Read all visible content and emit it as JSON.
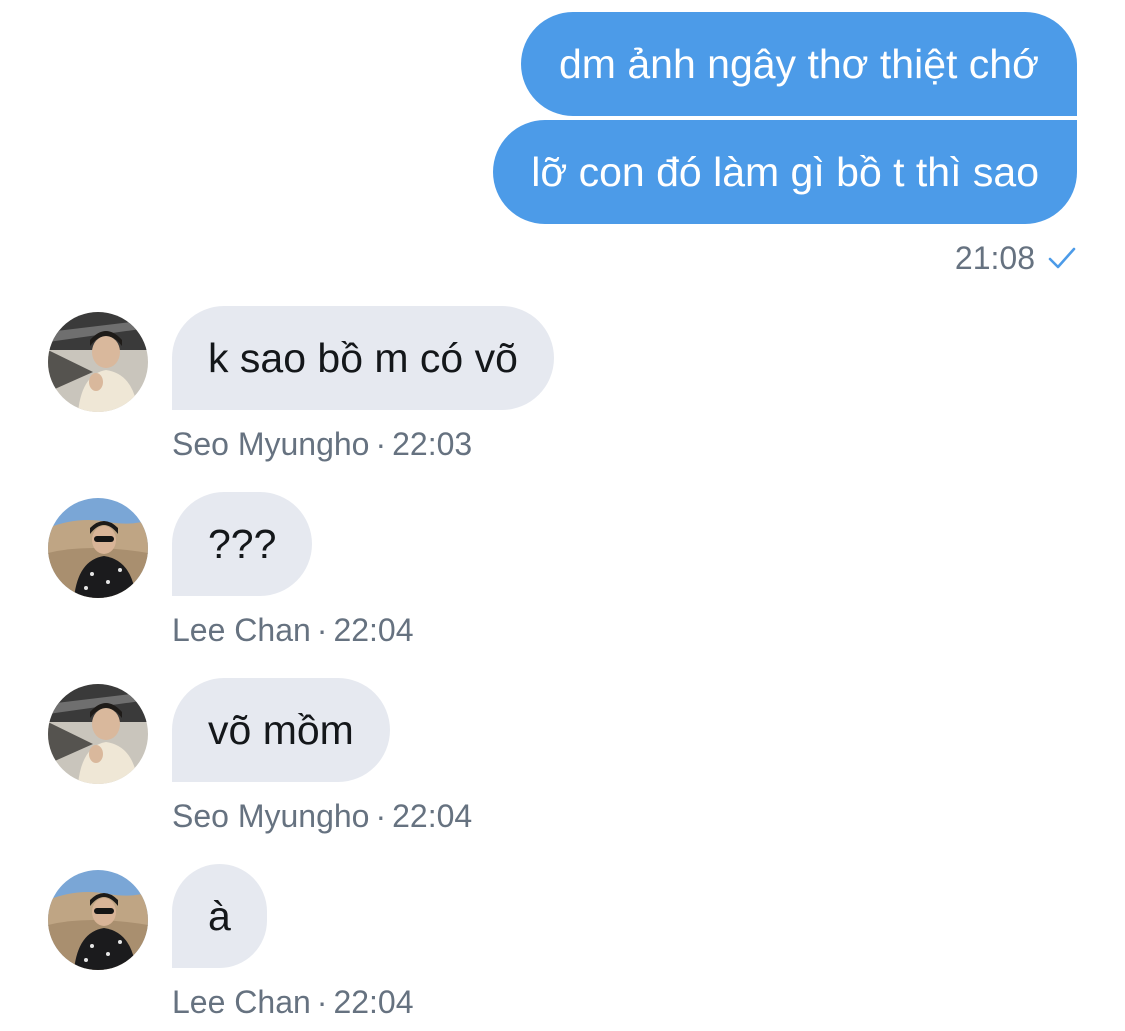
{
  "outgoing": {
    "messages": [
      "dm ảnh ngây thơ thiệt chớ",
      "lỡ con đó làm gì bồ t thì sao"
    ],
    "time": "21:08",
    "status_icon": "check-icon",
    "bubble_color": "#4c9be8"
  },
  "incoming": [
    {
      "text": "k sao bồ m có võ",
      "sender": "Seo Myungho",
      "time": "22:03"
    },
    {
      "text": "???",
      "sender": "Lee Chan",
      "time": "22:04"
    },
    {
      "text": "võ mồm",
      "sender": "Seo Myungho",
      "time": "22:04"
    },
    {
      "text": "à",
      "sender": "Lee Chan",
      "time": "22:04"
    }
  ],
  "meta_separator": "·",
  "colors": {
    "incoming_bubble": "#e6e9f0",
    "meta_text": "#667280",
    "accent": "#4c9be8"
  }
}
